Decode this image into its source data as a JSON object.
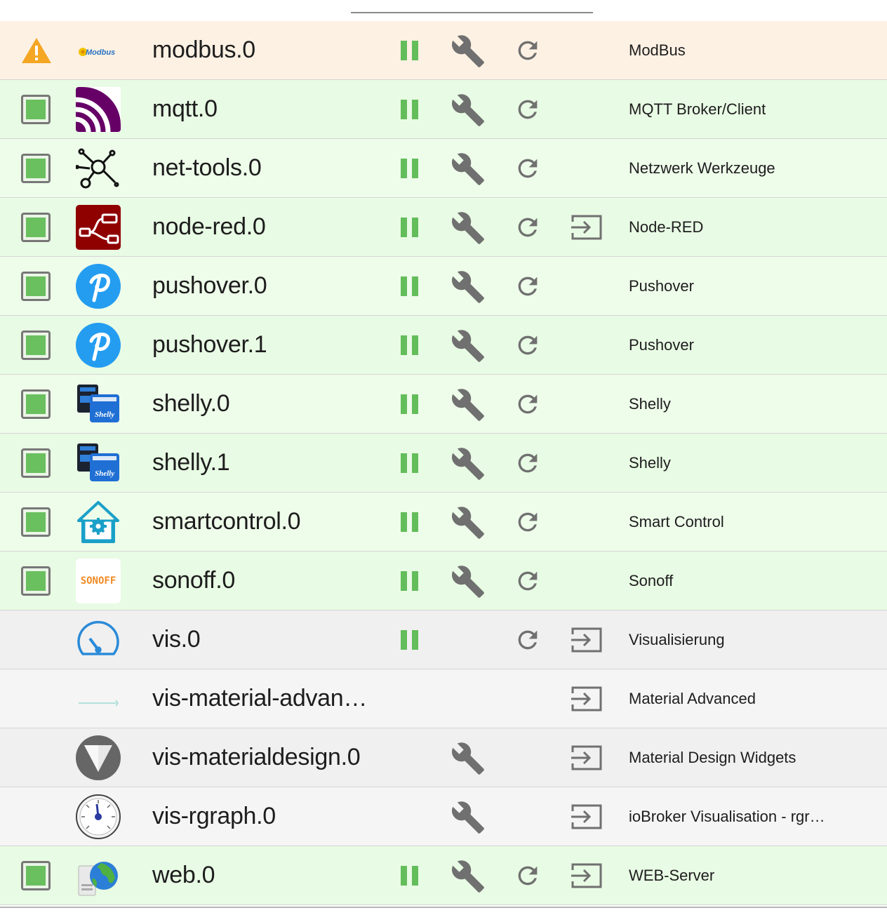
{
  "instances": [
    {
      "status": "warning",
      "status_icon": "warning-triangle-icon",
      "logo": "modbus",
      "logo_text": "Modbus",
      "name": "modbus.0",
      "pause": true,
      "settings": true,
      "reload": true,
      "open": false,
      "title": "ModBus",
      "bg": "warn"
    },
    {
      "status": "running",
      "status_icon": "running-status-icon",
      "logo": "mqtt",
      "name": "mqtt.0",
      "pause": true,
      "settings": true,
      "reload": true,
      "open": false,
      "title": "MQTT Broker/Client",
      "bg": "green"
    },
    {
      "status": "running",
      "status_icon": "running-status-icon",
      "logo": "net-tools",
      "name": "net-tools.0",
      "pause": true,
      "settings": true,
      "reload": true,
      "open": false,
      "title": "Netzwerk Werkzeuge",
      "bg": "green alt"
    },
    {
      "status": "running",
      "status_icon": "running-status-icon",
      "logo": "node-red",
      "name": "node-red.0",
      "pause": true,
      "settings": true,
      "reload": true,
      "open": true,
      "title": "Node-RED",
      "bg": "green"
    },
    {
      "status": "running",
      "status_icon": "running-status-icon",
      "logo": "pushover",
      "name": "pushover.0",
      "pause": true,
      "settings": true,
      "reload": true,
      "open": false,
      "title": "Pushover",
      "bg": "green alt"
    },
    {
      "status": "running",
      "status_icon": "running-status-icon",
      "logo": "pushover",
      "name": "pushover.1",
      "pause": true,
      "settings": true,
      "reload": true,
      "open": false,
      "title": "Pushover",
      "bg": "green"
    },
    {
      "status": "running",
      "status_icon": "running-status-icon",
      "logo": "shelly",
      "logo_text": "Shelly",
      "name": "shelly.0",
      "pause": true,
      "settings": true,
      "reload": true,
      "open": false,
      "title": "Shelly",
      "bg": "green alt"
    },
    {
      "status": "running",
      "status_icon": "running-status-icon",
      "logo": "shelly",
      "logo_text": "Shelly",
      "name": "shelly.1",
      "pause": true,
      "settings": true,
      "reload": true,
      "open": false,
      "title": "Shelly",
      "bg": "green"
    },
    {
      "status": "running",
      "status_icon": "running-status-icon",
      "logo": "smartcontrol",
      "name": "smartcontrol.0",
      "pause": true,
      "settings": true,
      "reload": true,
      "open": false,
      "title": "Smart Control",
      "bg": "green alt"
    },
    {
      "status": "running",
      "status_icon": "running-status-icon",
      "logo": "sonoff",
      "logo_text": "SONOFF",
      "name": "sonoff.0",
      "pause": true,
      "settings": true,
      "reload": true,
      "open": false,
      "title": "Sonoff",
      "bg": "green"
    },
    {
      "status": "none",
      "logo": "vis",
      "name": "vis.0",
      "pause": true,
      "settings": false,
      "reload": true,
      "open": true,
      "title": "Visualisierung",
      "bg": "grey"
    },
    {
      "status": "none",
      "logo": "vis-material-advanced",
      "name": "vis-material-advan…",
      "pause": false,
      "settings": false,
      "reload": false,
      "open": true,
      "title": "Material Advanced",
      "bg": "grey alt"
    },
    {
      "status": "none",
      "logo": "vis-materialdesign",
      "name": "vis-materialdesign.0",
      "pause": false,
      "settings": true,
      "reload": false,
      "open": true,
      "title": "Material Design Widgets",
      "bg": "grey"
    },
    {
      "status": "none",
      "logo": "vis-rgraph",
      "name": "vis-rgraph.0",
      "pause": false,
      "settings": true,
      "reload": false,
      "open": true,
      "title": "ioBroker Visualisation - rgr…",
      "bg": "grey alt"
    },
    {
      "status": "running",
      "status_icon": "running-status-icon",
      "logo": "web",
      "name": "web.0",
      "pause": true,
      "settings": true,
      "reload": true,
      "open": true,
      "title": "WEB-Server",
      "bg": "green"
    }
  ],
  "colors": {
    "green_accent": "#64bd5b",
    "icon_grey": "#707070",
    "warning": "#f5a623"
  }
}
